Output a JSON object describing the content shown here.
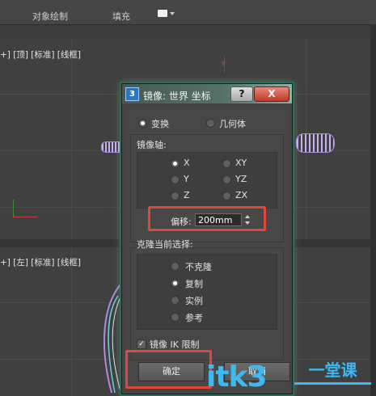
{
  "menubar": {
    "object_paint": "对象绘制",
    "fill": "填充"
  },
  "viewports": {
    "top": {
      "label": "+] [顶] [标准] [线框]",
      "axis": "y"
    },
    "left": {
      "label": "+] [左] [标准] [线框]",
      "axis": "y"
    }
  },
  "dialog": {
    "app_icon": "3",
    "title": "镜像: 世界 坐标",
    "help_label": "?",
    "close_label": "X",
    "transform_mode": {
      "transform": "变换",
      "geometry": "几何体",
      "selected": "变换"
    },
    "mirror_axis": {
      "heading": "镜像轴:",
      "options": [
        "X",
        "Y",
        "Z",
        "XY",
        "YZ",
        "ZX"
      ],
      "selected": "X",
      "offset_label": "偏移:",
      "offset_value": "200mm"
    },
    "clone_selection": {
      "heading": "克隆当前选择:",
      "options": [
        "不克隆",
        "复制",
        "实例",
        "参考"
      ],
      "selected": "复制"
    },
    "mirror_ik": {
      "label": "镜像 IK 限制",
      "checked": true
    },
    "ok_label": "确定",
    "cancel_label": "取消"
  },
  "watermark": {
    "text": "itk3",
    "subtitle": "一堂课"
  },
  "colors": {
    "highlight": "#e2463a",
    "watermark": "#3fb7ef",
    "selection": "#b08ae0"
  }
}
